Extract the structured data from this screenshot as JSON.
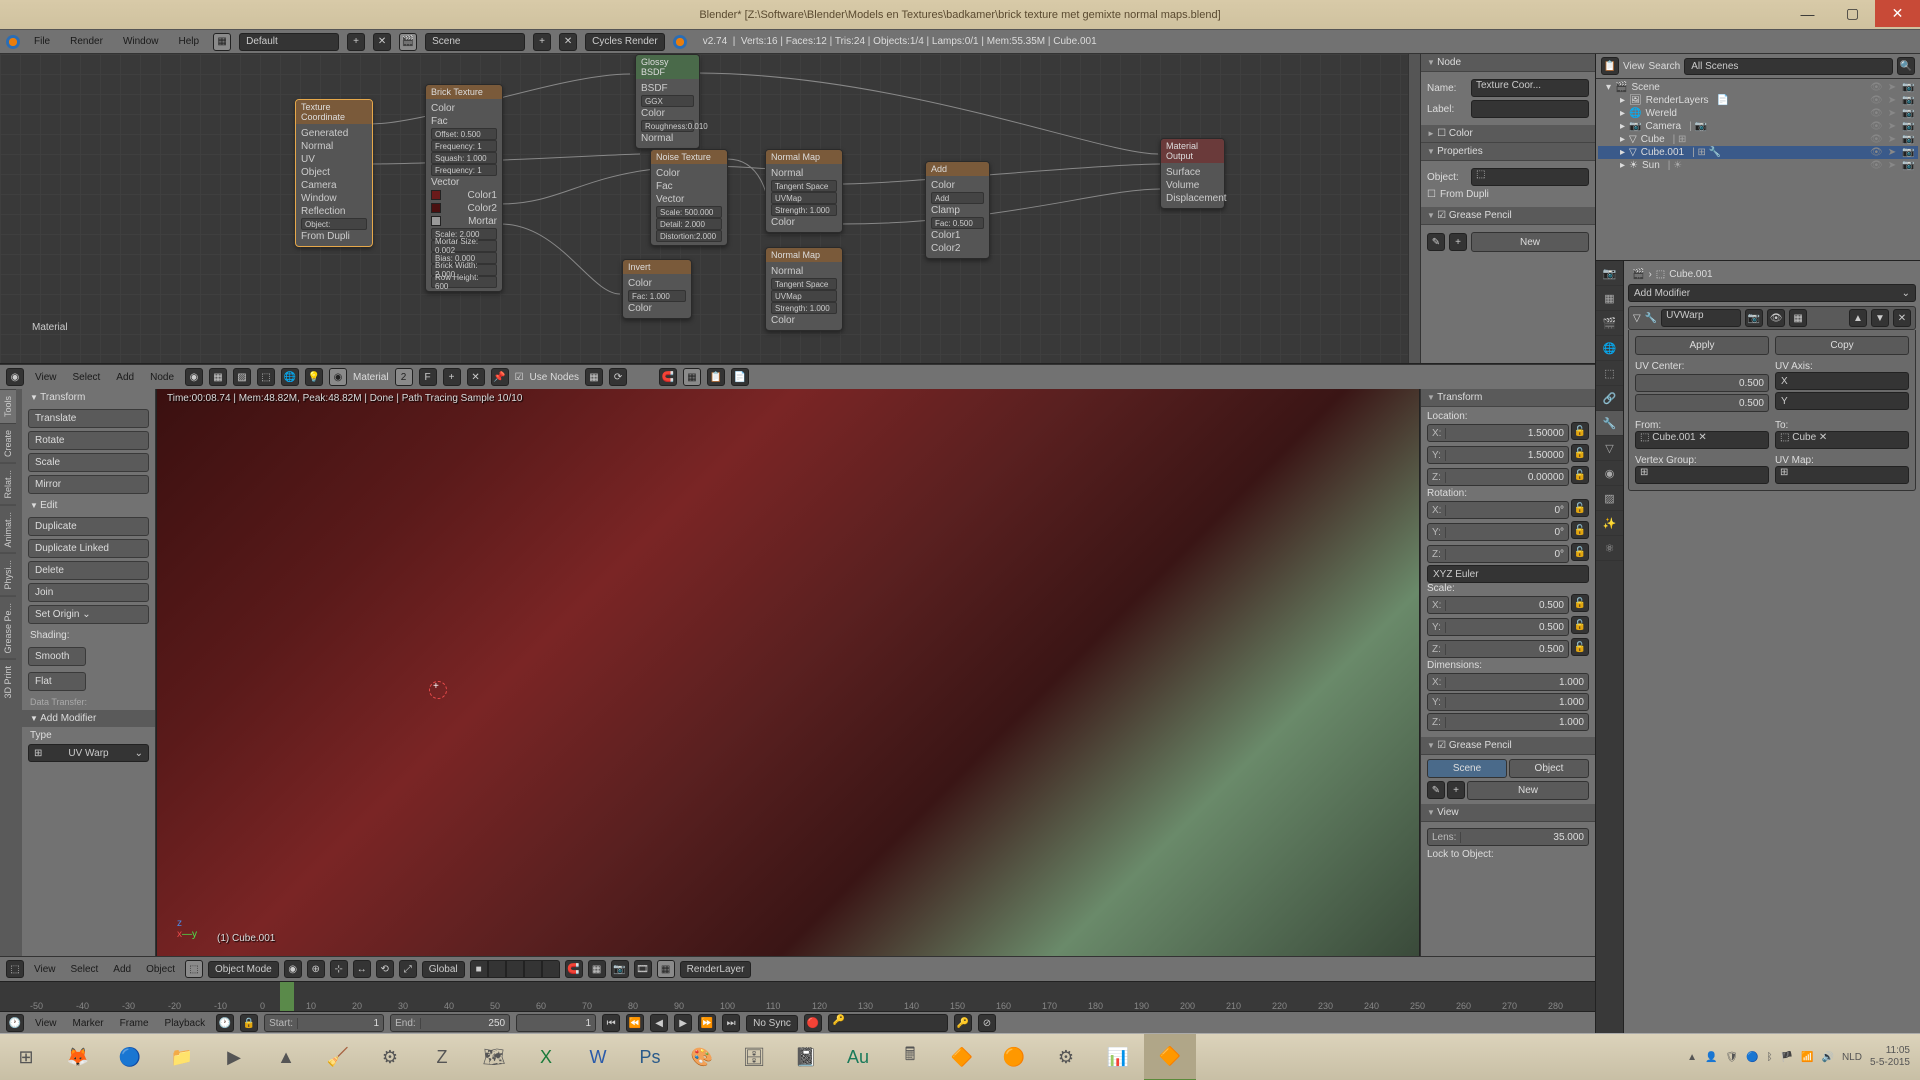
{
  "titlebar": {
    "title": "Blender* [Z:\\Software\\Blender\\Models en Textures\\badkamer\\brick texture met gemixte normal maps.blend]"
  },
  "infobar": {
    "menu": [
      "File",
      "Render",
      "Window",
      "Help"
    ],
    "layout": "Default",
    "scene": "Scene",
    "engine": "Cycles Render",
    "version": "v2.74",
    "stats": "Verts:16 | Faces:12 | Tris:24 | Objects:1/4 | Lamps:0/1 | Mem:55.35M | Cube.001"
  },
  "nodeeditor_menu": [
    "View",
    "Select",
    "Add",
    "Node"
  ],
  "nodeeditor": {
    "material": "Material",
    "users": "2",
    "use_nodes": "Use Nodes",
    "nodes": {
      "texcoord": {
        "title": "Texture Coordinate",
        "outs": [
          "Generated",
          "Normal",
          "UV",
          "Object",
          "Camera",
          "Window",
          "Reflection"
        ],
        "obj": "Object:",
        "from_dupli": "From Dupli"
      },
      "brick": {
        "title": "Brick Texture",
        "offset": "Offset:    0.500",
        "freq1": "Frequency: 1",
        "squash": "Squash:    1.000",
        "freq2": "Frequency: 1",
        "outs": [
          "Color",
          "Fac"
        ],
        "ins_vec": "Vector",
        "scale": "Scale:    2.000",
        "mortarsize": "Mortar Size: 0.002",
        "bias": "Bias:    0.000",
        "brickw": "Brick Width: 2.000",
        "rowh": "Row Height: 600"
      },
      "glossy": {
        "title": "Glossy BSDF",
        "dist": "GGX",
        "rough": "Roughness:0.010",
        "outs": [
          "BSDF"
        ]
      },
      "noise": {
        "title": "Noise Texture",
        "outs": [
          "Color",
          "Fac"
        ],
        "vec": "Vector",
        "scale": "Scale: 500.000",
        "detail": "Detail:    2.000",
        "distort": "Distortion:2.000"
      },
      "invert": {
        "title": "Invert",
        "outs": [
          "Color"
        ],
        "fac": "Fac:    1.000",
        "col": "Color"
      },
      "nmap1": {
        "title": "Normal Map",
        "space": "Tangent Space",
        "uv": "UVMap",
        "strength": "Strength:    1.000",
        "col": "Color",
        "outs": [
          "Normal"
        ]
      },
      "nmap2": {
        "title": "Normal Map",
        "space": "Tangent Space",
        "uv": "UVMap",
        "strength": "Strength:    1.000",
        "col": "Color",
        "outs": [
          "Normal"
        ]
      },
      "add": {
        "title": "Add",
        "op": "Add",
        "clamp": "Clamp",
        "fac": "Fac:    0.500",
        "c1": "Color1",
        "c2": "Color2",
        "outs": [
          "Color"
        ]
      },
      "output": {
        "title": "Material Output",
        "ins": [
          "Surface",
          "Volume",
          "Displacement"
        ]
      }
    },
    "material_label": "Material"
  },
  "node_npanel": {
    "node_h": "Node",
    "name_l": "Name:",
    "name_v": "Texture Coor...",
    "label_l": "Label:",
    "label_v": "",
    "color_h": "Color",
    "props_h": "Properties",
    "object_l": "Object:",
    "fromdup": "From Dupli",
    "gp_h": "Grease Pencil",
    "new_btn": "New"
  },
  "toolshelf": {
    "tabs": [
      "Tools",
      "Create",
      "Relat...",
      "Animat...",
      "Physi...",
      "Grease Pe...",
      "3D Print"
    ],
    "transform_h": "Transform",
    "translate": "Translate",
    "rotate": "Rotate",
    "scale": "Scale",
    "mirror": "Mirror",
    "edit_h": "Edit",
    "duplicate": "Duplicate",
    "duplinked": "Duplicate Linked",
    "delete": "Delete",
    "join": "Join",
    "setorigin": "Set Origin",
    "shading": "Shading:",
    "smooth": "Smooth",
    "flat": "Flat",
    "datatransfer": "Data Transfer:",
    "addmod_h": "Add Modifier",
    "type": "Type",
    "modifier": "UV Warp"
  },
  "viewport": {
    "render_info": "Time:00:08.74 | Mem:48.82M, Peak:48.82M | Done | Path Tracing Sample 10/10",
    "obj": "(1) Cube.001"
  },
  "npanel3d": {
    "transform_h": "Transform",
    "loc": "Location:",
    "rot": "Rotation:",
    "scale": "Scale:",
    "dim": "Dimensions:",
    "lx": "X:",
    "ly": "Y:",
    "lz": "Z:",
    "loc_v": [
      "1.50000",
      "1.50000",
      "0.00000"
    ],
    "rot_v": [
      "0°",
      "0°",
      "0°"
    ],
    "rotmode": "XYZ Euler",
    "scale_v": [
      "0.500",
      "0.500",
      "0.500"
    ],
    "dim_v": [
      "1.000",
      "1.000",
      "1.000"
    ],
    "gp_h": "Grease Pencil",
    "gp_scene": "Scene",
    "gp_obj": "Object",
    "gp_new": "New",
    "view_h": "View",
    "lens_l": "Lens:",
    "lens_v": "35.000",
    "lockobj": "Lock to Object:"
  },
  "viewheader": {
    "menu": [
      "View",
      "Select",
      "Add",
      "Object"
    ],
    "mode": "Object Mode",
    "orient": "Global",
    "layer": "RenderLayer"
  },
  "timeline": {
    "menu": [
      "View",
      "Marker",
      "Frame",
      "Playback"
    ],
    "start_l": "Start:",
    "start_v": "1",
    "end_l": "End:",
    "end_v": "250",
    "cur_v": "1",
    "sync": "No Sync",
    "ticks": [
      "-50",
      "-40",
      "-30",
      "-20",
      "-10",
      "0",
      "10",
      "20",
      "30",
      "40",
      "50",
      "60",
      "70",
      "80",
      "90",
      "100",
      "110",
      "120",
      "130",
      "140",
      "150",
      "160",
      "170",
      "180",
      "190",
      "200",
      "210",
      "220",
      "230",
      "240",
      "250",
      "260",
      "270",
      "280"
    ]
  },
  "outliner": {
    "header_menu": [
      "View",
      "Search"
    ],
    "filter": "All Scenes",
    "tree": [
      {
        "indent": 0,
        "icon": "🎬",
        "label": "Scene",
        "active": false
      },
      {
        "indent": 1,
        "icon": "🖼",
        "label": "RenderLayers",
        "active": false,
        "extra": "📄"
      },
      {
        "indent": 1,
        "icon": "🌐",
        "label": "Wereld",
        "active": false
      },
      {
        "indent": 1,
        "icon": "📷",
        "label": "Camera",
        "active": false,
        "extra": "| 📷"
      },
      {
        "indent": 1,
        "icon": "▽",
        "label": "Cube",
        "active": false,
        "extra": "| ⊞"
      },
      {
        "indent": 1,
        "icon": "▽",
        "label": "Cube.001",
        "active": true,
        "extra": "| ⊞ 🔧"
      },
      {
        "indent": 1,
        "icon": "☀",
        "label": "Sun",
        "active": false,
        "extra": "| ☀"
      }
    ]
  },
  "properties": {
    "breadcrumb_obj": "Cube.001",
    "addmod": "Add Modifier",
    "mod_name": "UVWarp",
    "apply": "Apply",
    "copy": "Copy",
    "center": "UV Center:",
    "axis": "UV Axis:",
    "center_v": [
      "0.500",
      "0.500"
    ],
    "axis_v": [
      "X",
      "Y"
    ],
    "from": "From:",
    "to": "To:",
    "from_v": "Cube.001",
    "to_v": "Cube",
    "vgroup": "Vertex Group:",
    "uvmap": "UV Map:"
  },
  "taskbar": {
    "lang": "NLD",
    "time": "11:05",
    "date": "5-5-2015"
  }
}
